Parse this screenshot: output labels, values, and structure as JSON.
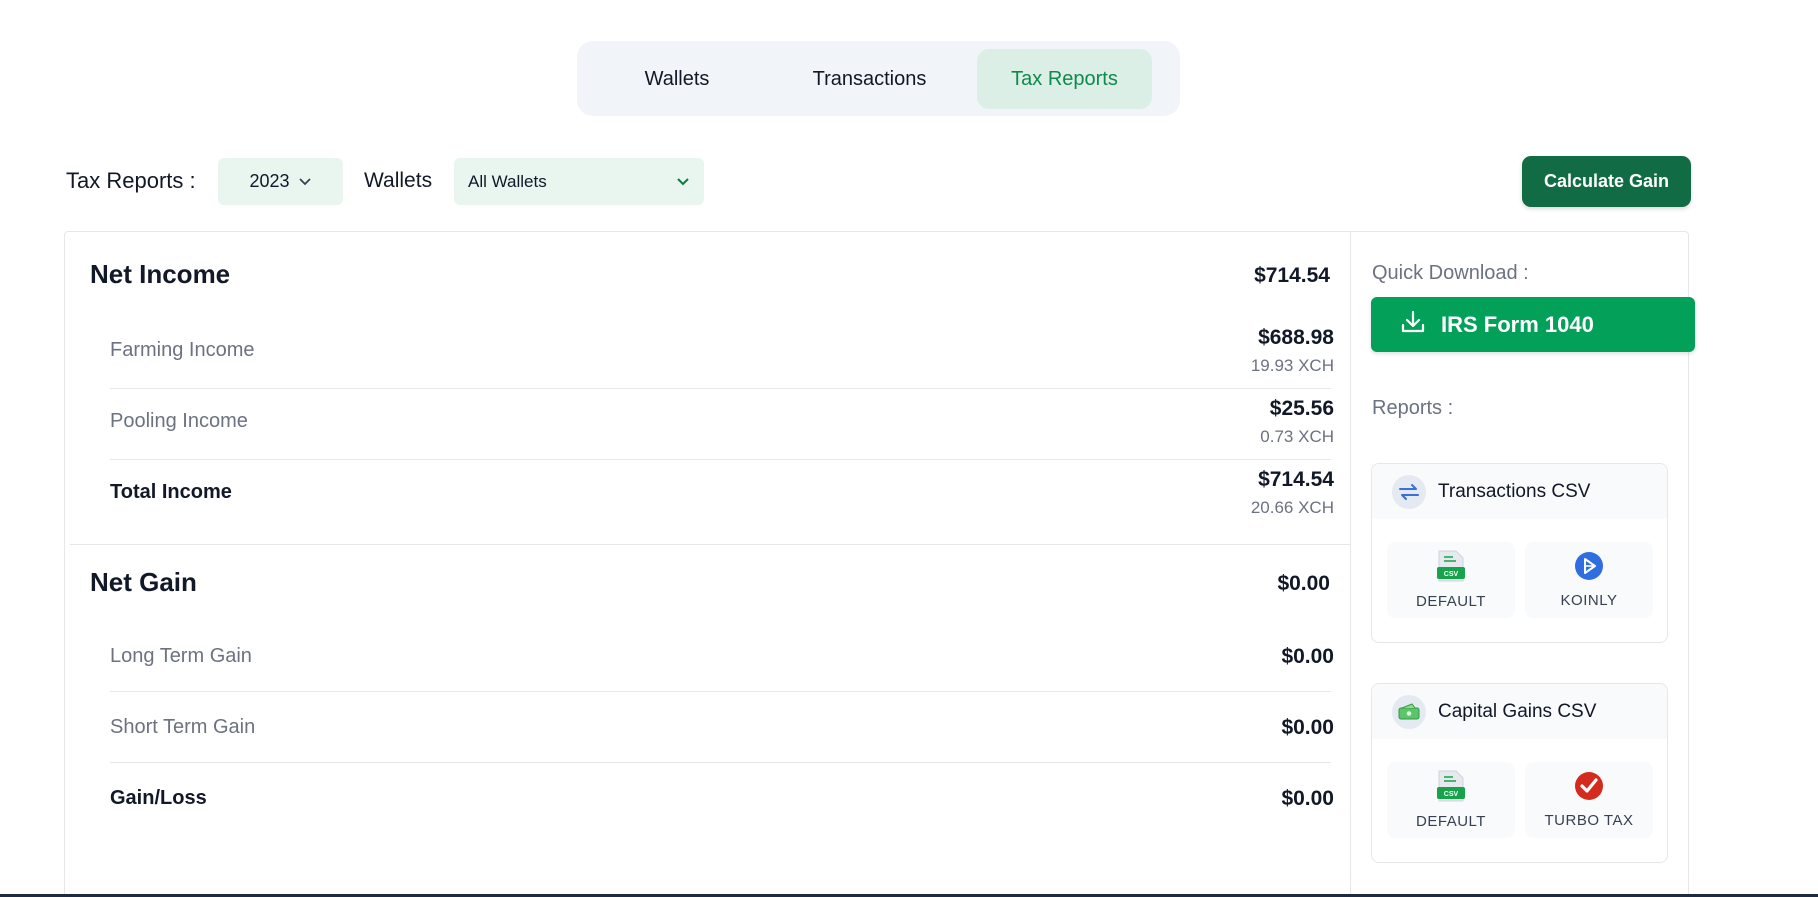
{
  "tabs": [
    {
      "label": "Wallets"
    },
    {
      "label": "Transactions"
    },
    {
      "label": "Tax Reports"
    }
  ],
  "toolbar": {
    "title": "Tax Reports :",
    "year": "2023",
    "wallets_label": "Wallets",
    "wallet_selected": "All Wallets",
    "calculate_label": "Calculate Gain"
  },
  "income": {
    "title": "Net Income",
    "total": "$714.54",
    "rows": [
      {
        "label": "Farming Income",
        "usd": "$688.98",
        "xch": "19.93 XCH"
      },
      {
        "label": "Pooling Income",
        "usd": "$25.56",
        "xch": "0.73 XCH"
      },
      {
        "label": "Total Income",
        "usd": "$714.54",
        "xch": "20.66 XCH"
      }
    ]
  },
  "gain": {
    "title": "Net Gain",
    "total": "$0.00",
    "rows": [
      {
        "label": "Long Term Gain",
        "usd": "$0.00"
      },
      {
        "label": "Short Term Gain",
        "usd": "$0.00"
      },
      {
        "label": "Gain/Loss",
        "usd": "$0.00"
      }
    ]
  },
  "sidebar": {
    "quick_download_label": "Quick Download :",
    "irs_button": "IRS Form 1040",
    "reports_label": "Reports :",
    "reports": [
      {
        "title": "Transactions CSV",
        "icon": "transfer-arrows-icon",
        "options": [
          {
            "label": "DEFAULT",
            "icon": "csv-file-icon"
          },
          {
            "label": "KOINLY",
            "icon": "koinly-logo-icon"
          }
        ]
      },
      {
        "title": "Capital Gains CSV",
        "icon": "cash-icon",
        "options": [
          {
            "label": "DEFAULT",
            "icon": "csv-file-icon"
          },
          {
            "label": "TURBO TAX",
            "icon": "turbotax-check-icon"
          }
        ]
      }
    ]
  },
  "colors": {
    "accent_green": "#03a05a",
    "dark_green": "#116b44",
    "active_tab_bg": "#dcefe6",
    "select_bg": "#e8f6ef"
  }
}
